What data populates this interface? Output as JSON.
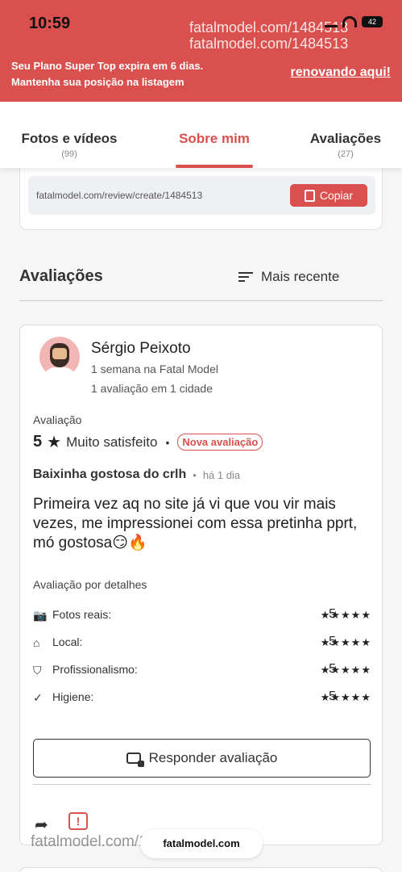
{
  "status_bar": {
    "time": "10:59",
    "battery": "42",
    "watermark_lines": [
      "fatalmodel.com/1484513",
      "fatalmodel.com/1484513"
    ]
  },
  "banner": {
    "promo_line1": "Seu Plano Super Top expira em 6 dias.",
    "promo_line2": "Mantenha sua posição na listagem",
    "link_label": "renovando aqui!",
    "color": "#d9504e"
  },
  "tabs": [
    {
      "label": "Fotos e vídeos",
      "count": "(99)"
    },
    {
      "label": "Sobre mim",
      "count": ""
    },
    {
      "label": "Avaliações",
      "count": "(27)"
    }
  ],
  "active_tab": "Sobre mim",
  "review_link": {
    "url": "fatalmodel.com/review/create/1484513",
    "copy_label": "Copiar"
  },
  "reviews_section": {
    "title": "Avaliações",
    "sort_label": "Mais recente"
  },
  "review": {
    "author": "Sérgio Peixoto",
    "member_since": "1 semana na Fatal Model",
    "review_count": "1 avaliação em 1 cidade",
    "rating_label": "Avaliação",
    "score": "5",
    "star": "★",
    "sentiment": "Muito satisfeito",
    "badge": "Nova avaliação",
    "title": "Baixinha gostosa do crlh",
    "ago": "há 1 dia",
    "text": "Primeira vez aq no site já vi que vou vir mais vezes, me impressionei com essa pretinha pprt, mó gostosa😏🔥",
    "details_label": "Avaliação por detalhes",
    "details": [
      {
        "icon": "camera-check-icon",
        "label": "Fotos reais:",
        "score": "5",
        "stars": "★★★★★"
      },
      {
        "icon": "home-icon",
        "label": "Local:",
        "score": "5",
        "stars": "★★★★★"
      },
      {
        "icon": "shield-check-icon",
        "label": "Profissionalismo:",
        "score": "5",
        "stars": "★★★★★"
      },
      {
        "icon": "check-circle-icon",
        "label": "Higiene:",
        "score": "5",
        "stars": "★★★★★"
      }
    ],
    "reply_label": "Responder avaliação"
  },
  "bottom": {
    "watermark": "fatalmodel.com/1484513",
    "url_pill": "fatalmodel.com"
  }
}
